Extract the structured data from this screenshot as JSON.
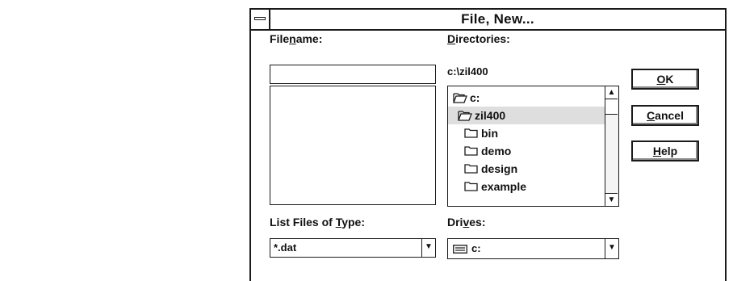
{
  "dialog": {
    "title": "File, New...",
    "filename": {
      "label_pre": "File",
      "label_mnemonic": "n",
      "label_post": "ame:",
      "value": ""
    },
    "directories": {
      "label_pre": "",
      "label_mnemonic": "D",
      "label_post": "irectories:",
      "current_path": "c:\\zil400",
      "items": [
        {
          "name": "c:",
          "icon": "open-folder-icon",
          "selected": false
        },
        {
          "name": "zil400",
          "icon": "open-folder-icon",
          "selected": true
        },
        {
          "name": "bin",
          "icon": "folder-icon",
          "selected": false
        },
        {
          "name": "demo",
          "icon": "folder-icon",
          "selected": false
        },
        {
          "name": "design",
          "icon": "folder-icon",
          "selected": false
        },
        {
          "name": "example",
          "icon": "folder-icon",
          "selected": false
        }
      ]
    },
    "file_type": {
      "label_pre": "List Files of ",
      "label_mnemonic": "T",
      "label_post": "ype:",
      "value": "*.dat"
    },
    "drives": {
      "label_pre": "Dri",
      "label_mnemonic": "v",
      "label_post": "es:",
      "value": "c:",
      "icon": "drive-icon"
    },
    "buttons": {
      "ok": {
        "mnemonic": "O",
        "rest": "K"
      },
      "cancel": {
        "mnemonic": "C",
        "rest": "ancel"
      },
      "help": {
        "mnemonic": "H",
        "rest": "elp"
      }
    }
  }
}
